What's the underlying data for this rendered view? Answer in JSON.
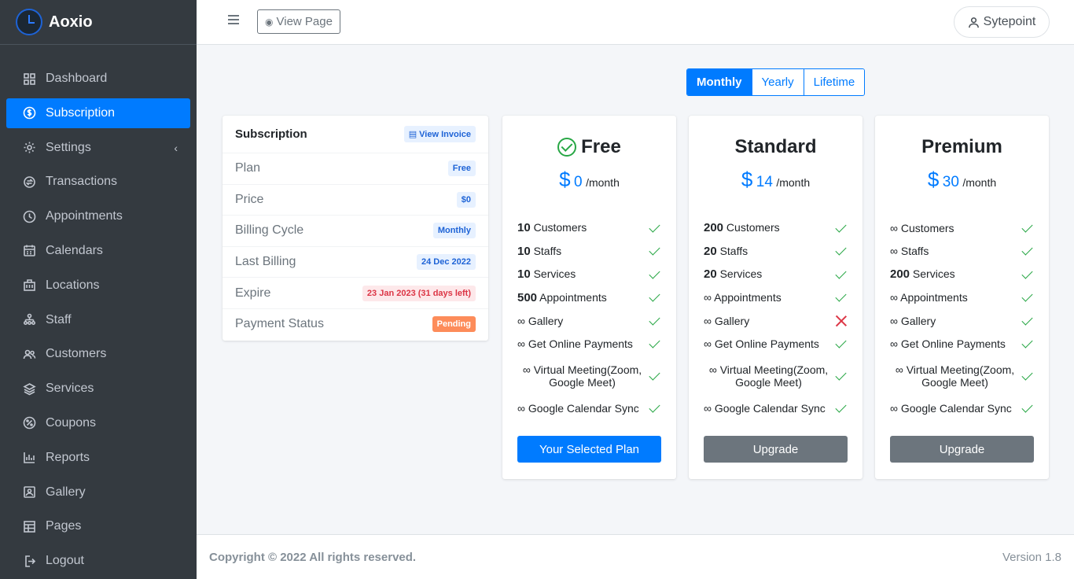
{
  "brand": {
    "name": "Aoxio"
  },
  "sidebar": {
    "items": [
      {
        "label": "Dashboard",
        "icon": "grid-icon"
      },
      {
        "label": "Subscription",
        "icon": "dollar-circle-icon",
        "active": true
      },
      {
        "label": "Settings",
        "icon": "gear-icon",
        "caret": "‹"
      },
      {
        "label": "Transactions",
        "icon": "transactions-icon"
      },
      {
        "label": "Appointments",
        "icon": "clock-icon"
      },
      {
        "label": "Calendars",
        "icon": "calendar-icon"
      },
      {
        "label": "Locations",
        "icon": "building-icon"
      },
      {
        "label": "Staff",
        "icon": "staff-icon"
      },
      {
        "label": "Customers",
        "icon": "users-icon"
      },
      {
        "label": "Services",
        "icon": "layers-icon"
      },
      {
        "label": "Coupons",
        "icon": "coupon-icon"
      },
      {
        "label": "Reports",
        "icon": "bar-chart-icon"
      },
      {
        "label": "Gallery",
        "icon": "image-icon"
      },
      {
        "label": "Pages",
        "icon": "table-icon"
      },
      {
        "label": "Logout",
        "icon": "logout-icon"
      }
    ]
  },
  "topbar": {
    "view_page_label": "View Page",
    "user_name": "Sytepoint"
  },
  "period_toggle": {
    "options": [
      "Monthly",
      "Yearly",
      "Lifetime"
    ],
    "selected": "Monthly"
  },
  "subscription": {
    "title": "Subscription",
    "invoice_button": "View Invoice",
    "rows": [
      {
        "label": "Plan",
        "value": "Free",
        "style": "blue"
      },
      {
        "label": "Price",
        "value": "$0",
        "style": "blue"
      },
      {
        "label": "Billing Cycle",
        "value": "Monthly",
        "style": "blue"
      },
      {
        "label": "Last Billing",
        "value": "24 Dec 2022",
        "style": "blue"
      },
      {
        "label": "Expire",
        "value": "23 Jan 2023 (31 days left)",
        "style": "red"
      },
      {
        "label": "Payment Status",
        "value": "Pending",
        "style": "orange"
      }
    ]
  },
  "plans": [
    {
      "name": "Free",
      "current": true,
      "currency": "$",
      "price": "0",
      "period": "/month",
      "features": [
        {
          "qty": "10",
          "label": "Customers",
          "included": true
        },
        {
          "qty": "10",
          "label": "Staffs",
          "included": true
        },
        {
          "qty": "10",
          "label": "Services",
          "included": true
        },
        {
          "qty": "500",
          "label": "Appointments",
          "included": true
        },
        {
          "qty": "∞",
          "label": "Gallery",
          "included": true
        },
        {
          "qty": "∞",
          "label": "Get Online Payments",
          "included": true
        },
        {
          "qty": "∞",
          "label": "Virtual Meeting(Zoom, Google Meet)",
          "included": true,
          "tall": true
        },
        {
          "qty": "∞",
          "label": "Google Calendar Sync",
          "included": true
        }
      ],
      "button": "Your Selected Plan",
      "button_style": "primary"
    },
    {
      "name": "Standard",
      "current": false,
      "currency": "$",
      "price": "14",
      "period": "/month",
      "features": [
        {
          "qty": "200",
          "label": "Customers",
          "included": true
        },
        {
          "qty": "20",
          "label": "Staffs",
          "included": true
        },
        {
          "qty": "20",
          "label": "Services",
          "included": true
        },
        {
          "qty": "∞",
          "label": "Appointments",
          "included": true
        },
        {
          "qty": "∞",
          "label": "Gallery",
          "included": false
        },
        {
          "qty": "∞",
          "label": "Get Online Payments",
          "included": true
        },
        {
          "qty": "∞",
          "label": "Virtual Meeting(Zoom, Google Meet)",
          "included": true,
          "tall": true
        },
        {
          "qty": "∞",
          "label": "Google Calendar Sync",
          "included": true
        }
      ],
      "button": "Upgrade",
      "button_style": "secondary"
    },
    {
      "name": "Premium",
      "current": false,
      "currency": "$",
      "price": "30",
      "period": "/month",
      "features": [
        {
          "qty": "∞",
          "label": "Customers",
          "included": true
        },
        {
          "qty": "∞",
          "label": "Staffs",
          "included": true
        },
        {
          "qty": "200",
          "label": "Services",
          "included": true
        },
        {
          "qty": "∞",
          "label": "Appointments",
          "included": true
        },
        {
          "qty": "∞",
          "label": "Gallery",
          "included": true
        },
        {
          "qty": "∞",
          "label": "Get Online Payments",
          "included": true
        },
        {
          "qty": "∞",
          "label": "Virtual Meeting(Zoom, Google Meet)",
          "included": true,
          "tall": true
        },
        {
          "qty": "∞",
          "label": "Google Calendar Sync",
          "included": true
        }
      ],
      "button": "Upgrade",
      "button_style": "secondary"
    }
  ],
  "footer": {
    "copyright": "Copyright © 2022 All rights reserved.",
    "version": "Version 1.8"
  },
  "colors": {
    "primary": "#007bff",
    "sidebar": "#343a40",
    "success": "#28a745",
    "danger": "#dc3545",
    "secondary": "#6c757d"
  }
}
